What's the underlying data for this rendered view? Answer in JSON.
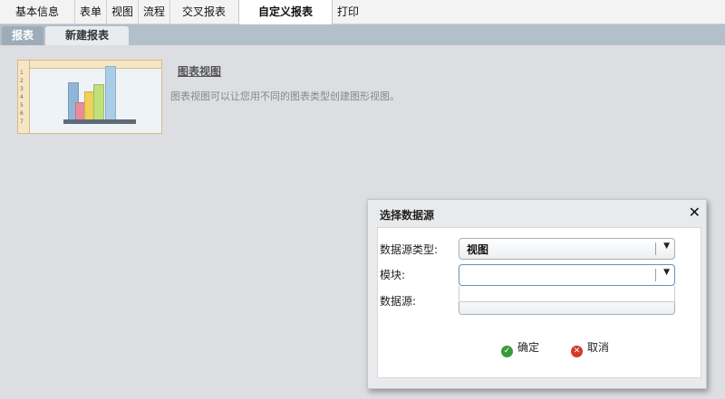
{
  "top_tabs": [
    {
      "label": "基本信息"
    },
    {
      "label": "表单"
    },
    {
      "label": "视图"
    },
    {
      "label": "流程"
    },
    {
      "label": "交叉报表"
    },
    {
      "label": "自定义报表"
    },
    {
      "label": "打印"
    }
  ],
  "sub_tabs": [
    {
      "label": "报表"
    },
    {
      "label": "新建报表"
    }
  ],
  "chart_view": {
    "title": "图表视图",
    "description": "图表视图可以让您用不同的图表类型创建图形视图。"
  },
  "dialog": {
    "title": "选择数据源",
    "close_symbol": "✕",
    "field_type_label": "数据源类型:",
    "field_type_value": "视图",
    "field_module_label": "模块:",
    "field_module_value": "",
    "field_source_label": "数据源:",
    "ok_label": "确定",
    "cancel_label": "取消"
  },
  "colors": {
    "accent_ok": "#3a9a3a",
    "accent_cancel": "#d23a2a",
    "tabbar": "#b3bfc9"
  }
}
